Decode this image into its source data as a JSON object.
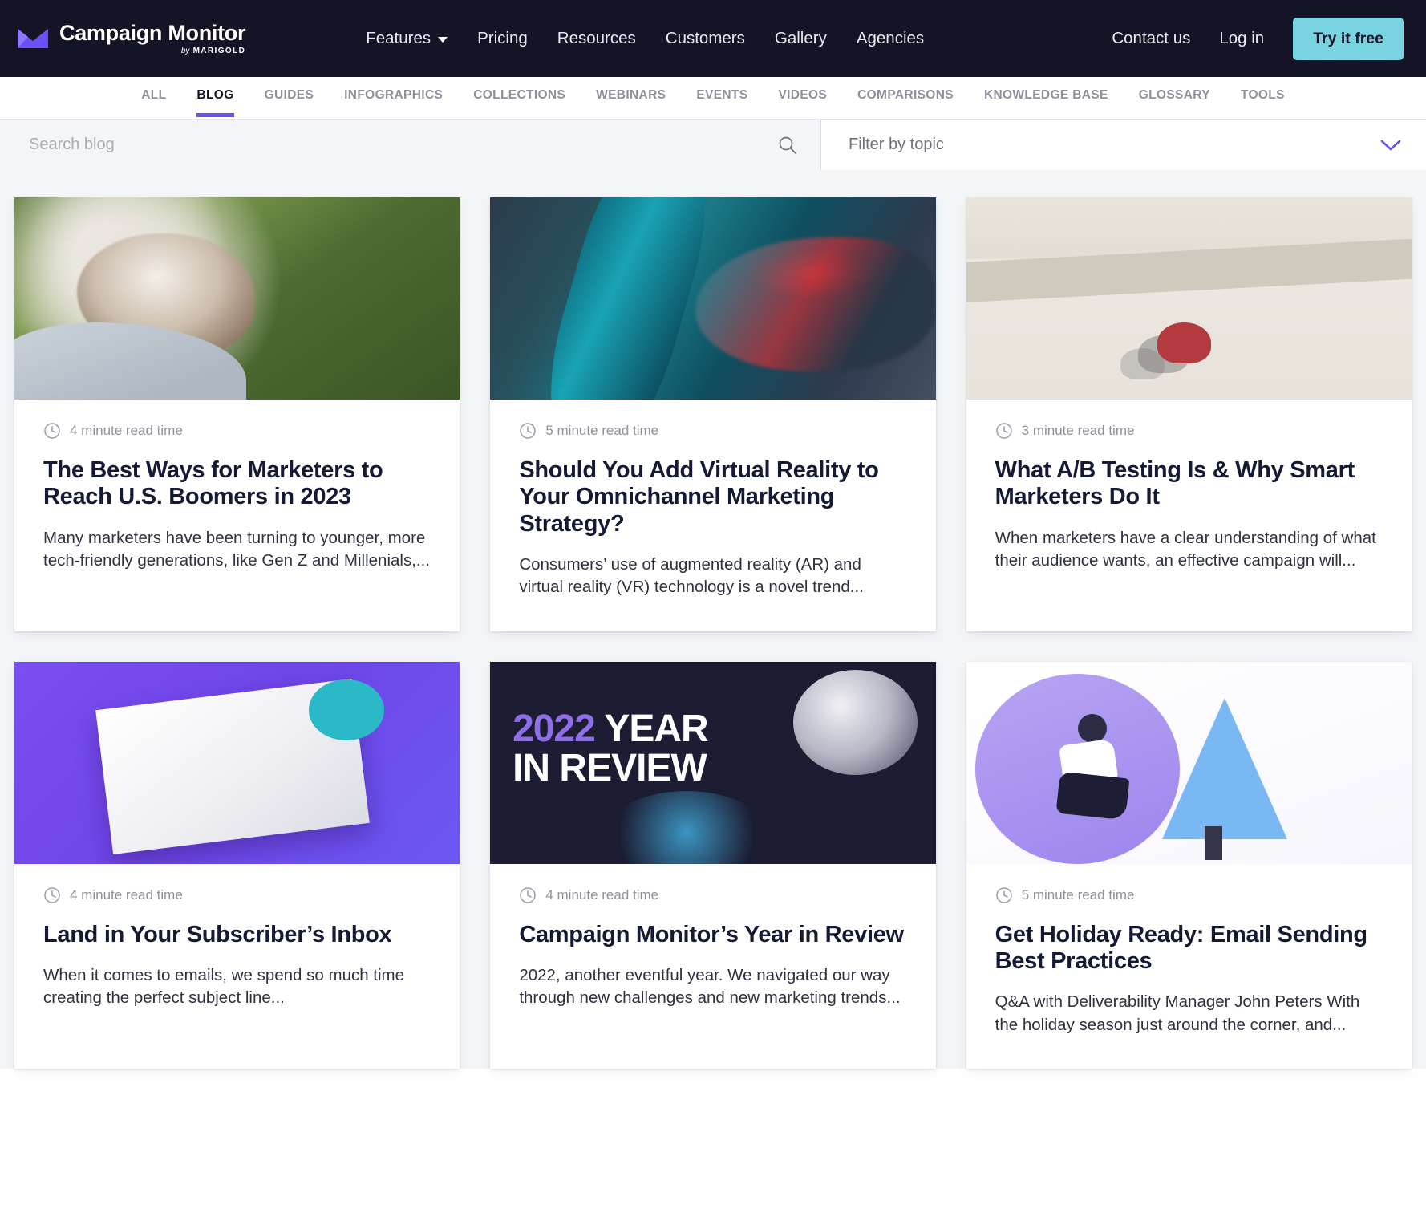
{
  "topnav": {
    "brand": {
      "name": "Campaign Monitor",
      "by": "by",
      "parent": "MARIGOLD"
    },
    "menu": [
      {
        "label": "Features",
        "has_caret": true
      },
      {
        "label": "Pricing",
        "has_caret": false
      },
      {
        "label": "Resources",
        "has_caret": false
      },
      {
        "label": "Customers",
        "has_caret": false
      },
      {
        "label": "Gallery",
        "has_caret": false
      },
      {
        "label": "Agencies",
        "has_caret": false
      }
    ],
    "contact_label": "Contact us",
    "login_label": "Log in",
    "cta_label": "Try it free",
    "background_color": "#141426",
    "cta_color": "#7ad3e0"
  },
  "subnav": {
    "active": "BLOG",
    "underline_color": "#6c4ff7",
    "items": [
      {
        "label": "ALL"
      },
      {
        "label": "BLOG"
      },
      {
        "label": "GUIDES"
      },
      {
        "label": "INFOGRAPHICS"
      },
      {
        "label": "COLLECTIONS"
      },
      {
        "label": "WEBINARS"
      },
      {
        "label": "EVENTS"
      },
      {
        "label": "VIDEOS"
      },
      {
        "label": "COMPARISONS"
      },
      {
        "label": "KNOWLEDGE BASE"
      },
      {
        "label": "GLOSSARY"
      },
      {
        "label": "TOOLS"
      }
    ]
  },
  "search": {
    "placeholder": "Search blog",
    "value": "",
    "icon": "search-icon"
  },
  "filter": {
    "placeholder": "Filter by topic",
    "selected": "Filter by topic",
    "icon": "chevron-down-icon"
  },
  "cards": [
    {
      "read_time": "4 minute read time",
      "title": "The Best Ways for Marketers to Reach U.S. Boomers in 2023",
      "excerpt": "Many marketers have been turning to younger, more tech-friendly generations, like Gen Z and Millenials,...",
      "art": "art-boomer",
      "image_alt": "smiling-older-woman-photo"
    },
    {
      "read_time": "5 minute read time",
      "title": "Should You Add Virtual Reality to Your Omnichannel Marketing Strategy?",
      "excerpt": "Consumers’ use of augmented reality (AR) and virtual reality (VR) technology is a novel trend...",
      "art": "art-vr",
      "image_alt": "teal-abstract-render"
    },
    {
      "read_time": "3 minute read time",
      "title": "What A/B Testing Is & Why Smart Marketers Do It",
      "excerpt": "When marketers have a clear understanding of what their audience wants, an effective campaign will...",
      "art": "art-ab",
      "image_alt": "aerial-person-on-sand"
    },
    {
      "read_time": "4 minute read time",
      "title": "Land in Your Subscriber’s Inbox",
      "excerpt": "When it comes to emails, we spend so much time creating the perfect subject line...",
      "art": "art-envelope",
      "image_alt": "envelope-with-notification-badge"
    },
    {
      "read_time": "4 minute read time",
      "title": "Campaign Monitor’s Year in Review",
      "excerpt": "2022, another eventful year. We navigated our way through new challenges and new marketing trends...",
      "art": "art-year",
      "image_alt": "2022-year-in-review-graphic",
      "overlay_line1_highlight": "2022",
      "overlay_line1_rest": " YEAR",
      "overlay_line2": "IN REVIEW"
    },
    {
      "read_time": "5 minute read time",
      "title": "Get Holiday Ready: Email Sending Best Practices",
      "excerpt": "Q&A with Deliverability Manager John Peters With the holiday season just around the corner, and...",
      "art": "art-holiday",
      "image_alt": "person-sitting-by-tree-illustration"
    }
  ]
}
